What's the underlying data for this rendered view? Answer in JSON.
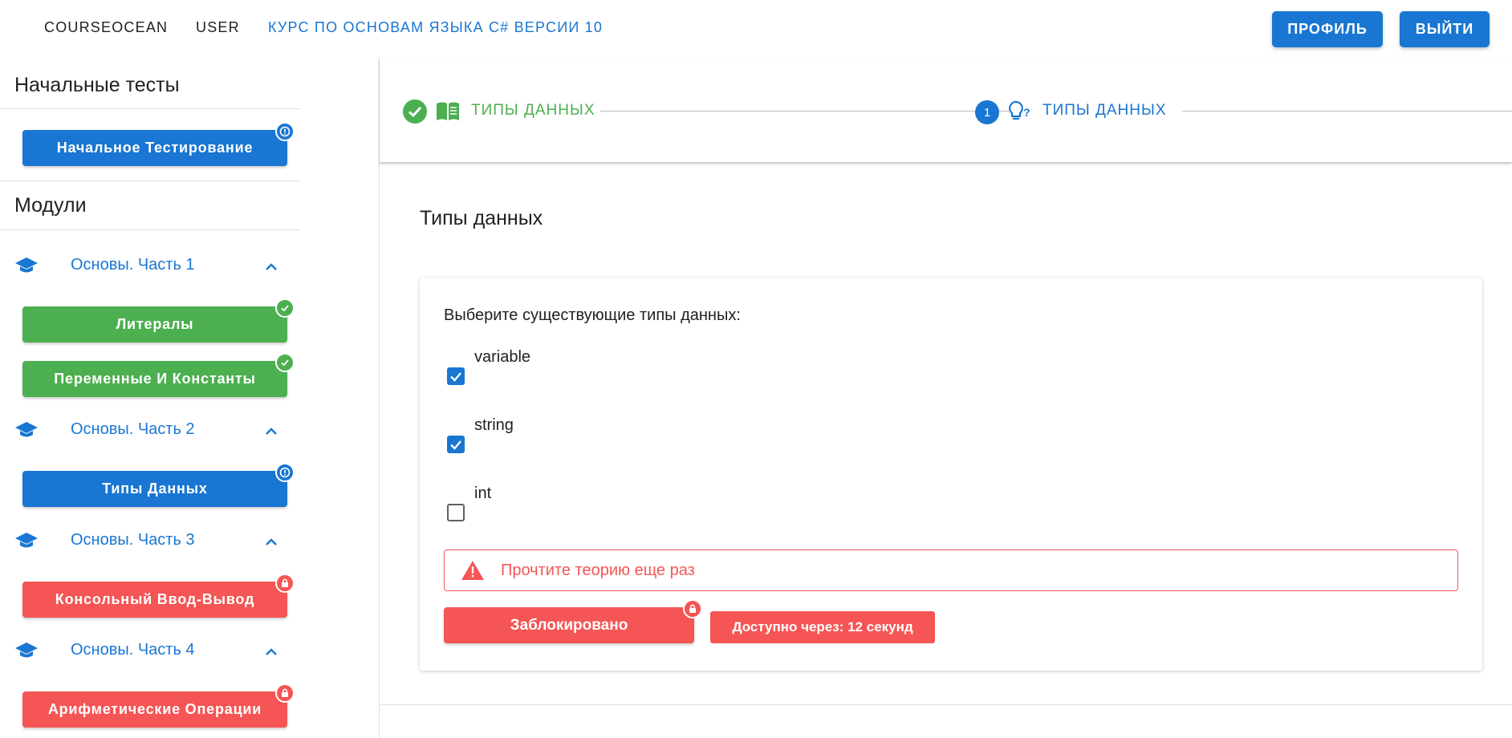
{
  "nav": {
    "brand": "COURSEOCEAN",
    "user": "USER",
    "course": "КУРС ПО ОСНОВАМ ЯЗЫКА C# ВЕРСИИ 10",
    "profile_btn": "ПРОФИЛЬ",
    "logout_btn": "ВЫЙТИ"
  },
  "sidebar": {
    "tests_heading": "Начальные тесты",
    "initial_test_btn": "Начальное Тестирование",
    "modules_heading": "Модули",
    "modules": [
      {
        "label": "Основы. Часть 1"
      },
      {
        "label": "Основы. Часть 2"
      },
      {
        "label": "Основы. Часть 3"
      },
      {
        "label": "Основы. Часть 4"
      }
    ],
    "lessons": [
      {
        "label": "Литералы",
        "status": "completed"
      },
      {
        "label": "Переменные И Константы",
        "status": "completed"
      },
      {
        "label": "Типы Данных",
        "status": "current"
      },
      {
        "label": "Консольный Ввод-Вывод",
        "status": "locked"
      },
      {
        "label": "Арифметические Операции",
        "status": "locked"
      }
    ]
  },
  "stepper": {
    "steps": [
      {
        "label": "ТИПЫ ДАННЫХ",
        "state": "completed",
        "icon": "book-icon"
      },
      {
        "label": "ТИПЫ ДАННЫХ",
        "state": "active",
        "number": "1",
        "icon": "lightbulb-question-icon"
      }
    ]
  },
  "content": {
    "title": "Типы данных",
    "question": "Выберите существующие типы данных:",
    "options": [
      {
        "label": "variable",
        "checked": true
      },
      {
        "label": "string",
        "checked": true
      },
      {
        "label": "int",
        "checked": false
      }
    ],
    "alert": "Прочтите теорию еще раз",
    "locked_btn": "Заблокировано",
    "timer": "Доступно через: 12 секунд"
  },
  "colors": {
    "primary": "#1976d2",
    "success": "#4caf50",
    "error": "#f55555"
  }
}
